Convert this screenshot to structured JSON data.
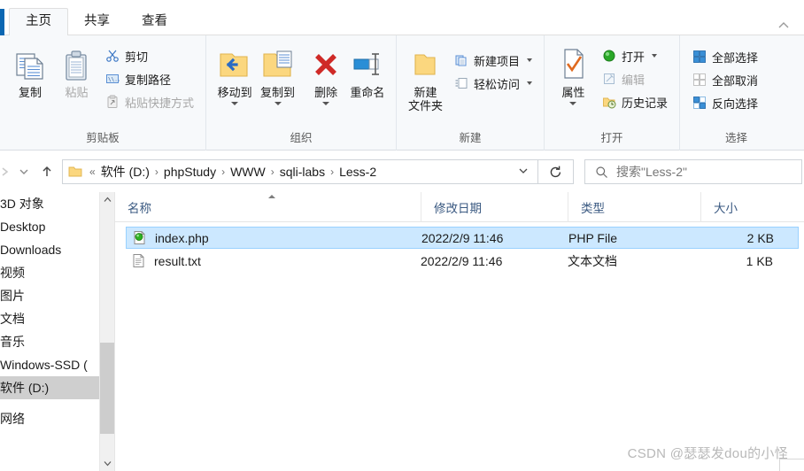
{
  "window": {
    "tabs": [
      {
        "label": "主页",
        "active": true
      },
      {
        "label": "共享",
        "active": false
      },
      {
        "label": "查看",
        "active": false
      }
    ],
    "collapse_ribbon_icon": "chevron-up-icon"
  },
  "ribbon": {
    "groups": [
      {
        "name": "clipboard",
        "label": "剪贴板",
        "big_buttons": [
          {
            "label": "复制",
            "icon": "copy-icon",
            "disabled": false
          },
          {
            "label": "粘贴",
            "icon": "paste-clipboard-icon",
            "disabled": true
          }
        ],
        "small_buttons": [
          {
            "label": "剪切",
            "icon": "scissors-icon",
            "disabled": false
          },
          {
            "label": "复制路径",
            "icon": "copy-path-icon",
            "disabled": false
          },
          {
            "label": "粘贴快捷方式",
            "icon": "paste-shortcut-icon",
            "disabled": true
          }
        ]
      },
      {
        "name": "organize",
        "label": "组织",
        "big_buttons": [
          {
            "label": "移动到",
            "icon": "move-to-folder-icon",
            "dropdown": true
          },
          {
            "label": "复制到",
            "icon": "copy-to-folder-icon",
            "dropdown": true
          },
          {
            "label": "删除",
            "icon": "delete-x-icon",
            "dropdown": true
          },
          {
            "label": "重命名",
            "icon": "rename-icon",
            "dropdown": false
          }
        ]
      },
      {
        "name": "new",
        "label": "新建",
        "big_buttons": [
          {
            "label": "新建\n文件夹",
            "label_line1": "新建",
            "label_line2": "文件夹",
            "icon": "new-folder-icon"
          }
        ],
        "small_buttons": [
          {
            "label": "新建项目",
            "icon": "new-item-icon",
            "dropdown": true
          },
          {
            "label": "轻松访问",
            "icon": "easy-access-icon",
            "dropdown": true
          }
        ]
      },
      {
        "name": "open",
        "label": "打开",
        "big_buttons": [
          {
            "label": "属性",
            "icon": "properties-icon",
            "dropdown": true
          }
        ],
        "small_buttons": [
          {
            "label": "打开",
            "icon": "open-green-icon",
            "dropdown": true,
            "disabled": false
          },
          {
            "label": "编辑",
            "icon": "edit-pencil-icon",
            "disabled": true
          },
          {
            "label": "历史记录",
            "icon": "history-icon",
            "disabled": false
          }
        ]
      },
      {
        "name": "select",
        "label": "选择",
        "small_buttons": [
          {
            "label": "全部选择",
            "icon": "select-all-icon"
          },
          {
            "label": "全部取消",
            "icon": "select-none-icon"
          },
          {
            "label": "反向选择",
            "icon": "invert-selection-icon"
          }
        ]
      }
    ]
  },
  "addressbar": {
    "back_icon": "arrow-left-icon",
    "forward_icon": "arrow-right-icon",
    "recent_icon": "chevron-down-icon",
    "up_icon": "arrow-up-icon",
    "folder_icon": "folder-icon",
    "overflow": "«",
    "crumbs": [
      "软件 (D:)",
      "phpStudy",
      "WWW",
      "sqli-labs",
      "Less-2"
    ],
    "separator": "›",
    "dropdown_icon": "chevron-down-icon",
    "refresh_icon": "refresh-icon",
    "search": {
      "icon": "search-icon",
      "placeholder": "搜索\"Less-2\"",
      "value": ""
    }
  },
  "nav_pane": {
    "items": [
      {
        "label": "3D 对象",
        "selected": false
      },
      {
        "label": "Desktop",
        "selected": false
      },
      {
        "label": "Downloads",
        "selected": false
      },
      {
        "label": "视频",
        "selected": false
      },
      {
        "label": "图片",
        "selected": false
      },
      {
        "label": "文档",
        "selected": false
      },
      {
        "label": "音乐",
        "selected": false
      },
      {
        "label": "Windows-SSD (",
        "selected": false
      },
      {
        "label": "软件 (D:)",
        "selected": true
      },
      {
        "label": "网络",
        "selected": false
      }
    ],
    "scrollbar": {
      "up_icon": "chevron-up-icon",
      "down_icon": "chevron-down-icon"
    }
  },
  "file_list": {
    "columns": [
      {
        "label": "名称",
        "sorted": "asc"
      },
      {
        "label": "修改日期",
        "sorted": ""
      },
      {
        "label": "类型",
        "sorted": ""
      },
      {
        "label": "大小",
        "sorted": ""
      }
    ],
    "rows": [
      {
        "name": "index.php",
        "date": "2022/2/9 11:46",
        "type": "PHP File",
        "size": "2 KB",
        "icon": "php-file-icon",
        "selected": true
      },
      {
        "name": "result.txt",
        "date": "2022/2/9 11:46",
        "type": "文本文档",
        "size": "1 KB",
        "icon": "text-file-icon",
        "selected": false
      }
    ]
  },
  "watermark": {
    "text": "CSDN @瑟瑟发dou的小怪"
  },
  "colors": {
    "accent": "#0b67b2",
    "selection": "#cce8ff",
    "selection_border": "#99d1ff",
    "nav_selected": "#cfcfcf",
    "header_text": "#3b5a82",
    "ribbon_bg": "#f7f9fb",
    "folder_yellow": "#fbd77f",
    "delete_red": "#cf2a27",
    "open_green": "#2aa828"
  }
}
